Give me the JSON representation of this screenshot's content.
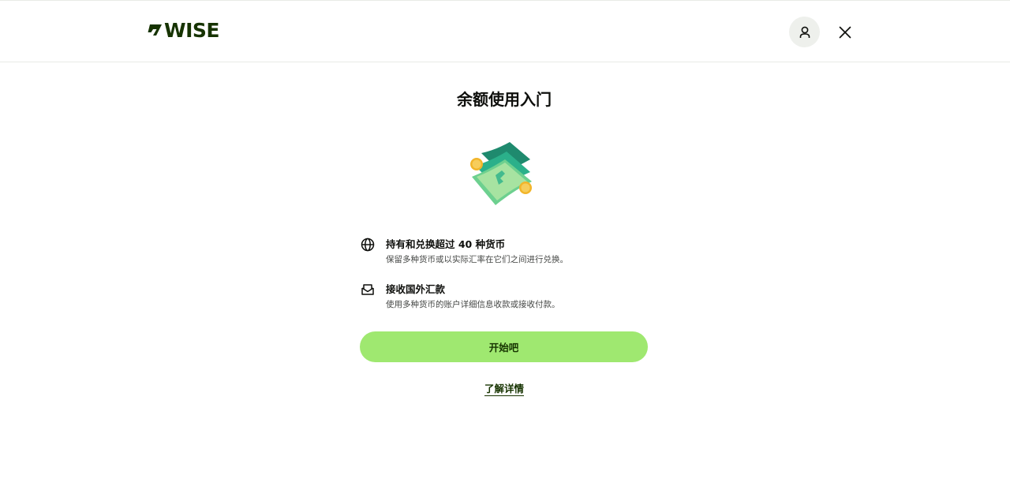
{
  "header": {
    "logo_text": "WISE",
    "profile_icon": "user-icon",
    "close_icon": "close-icon"
  },
  "main": {
    "title": "余额使用入门",
    "illustration_icon": "money-banknotes-illustration",
    "features": [
      {
        "icon": "globe-icon",
        "title": "持有和兑换超过 40 种货币",
        "description": "保留多种货币或以实际汇率在它们之间进行兑换。"
      },
      {
        "icon": "receive-mail-icon",
        "title": "接收国外汇款",
        "description": "使用多种货币的账户详细信息收款或接收付款。"
      }
    ],
    "primary_button_label": "开始吧",
    "learn_more_label": "了解详情"
  },
  "colors": {
    "brand_green": "#9fe870",
    "forest_green": "#163300",
    "text": "#0e0f0c"
  }
}
